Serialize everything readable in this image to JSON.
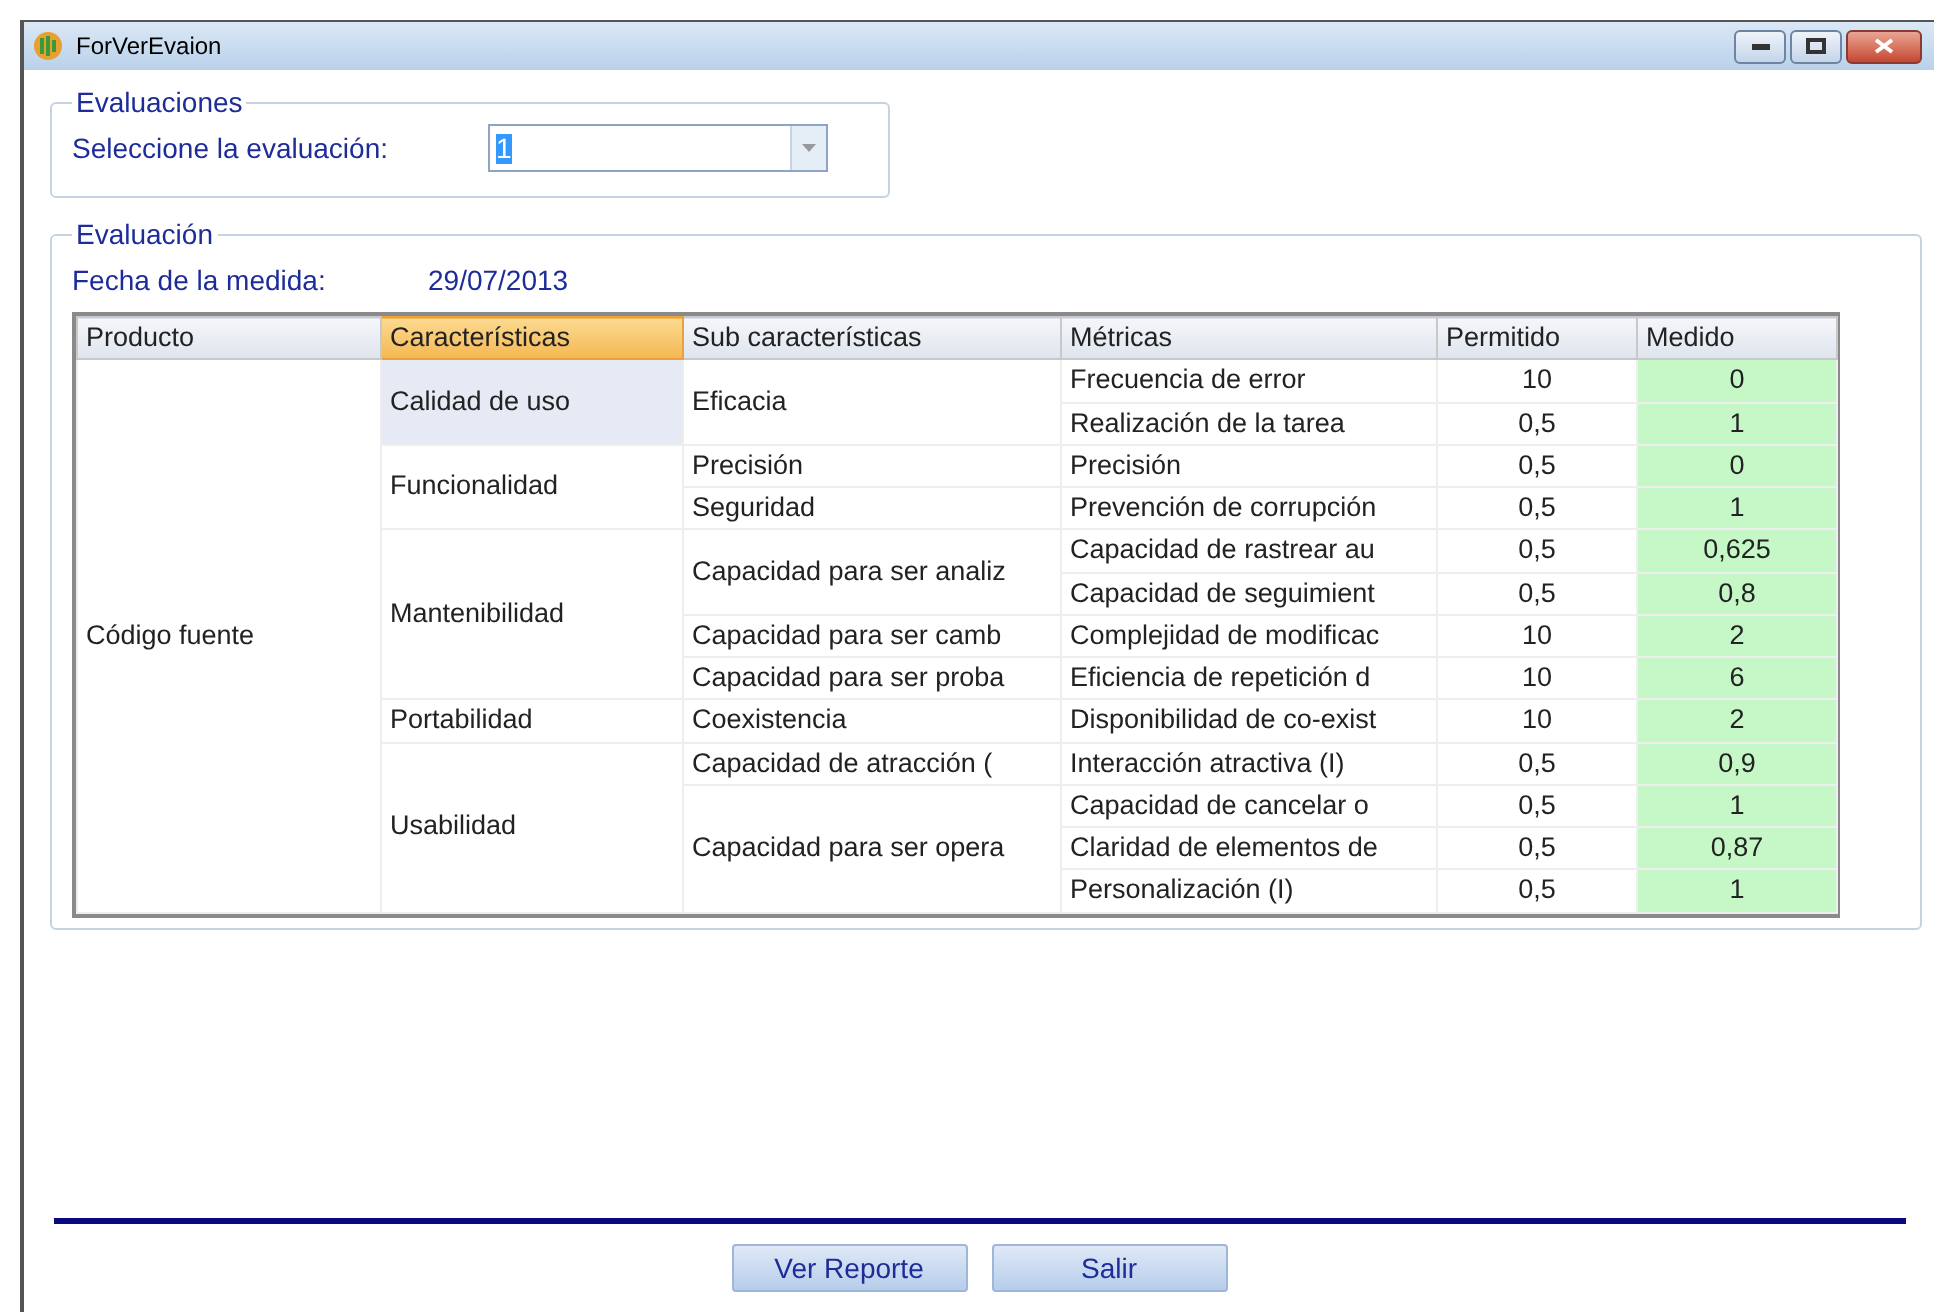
{
  "window": {
    "title": "ForVerEvaion"
  },
  "evaluaciones": {
    "legend": "Evaluaciones",
    "label": "Seleccione la evaluación:",
    "value": "1"
  },
  "evaluacion": {
    "legend": "Evaluación",
    "date_label": "Fecha de la medida:",
    "date": "29/07/2013"
  },
  "table": {
    "columns": [
      {
        "label": "Producto",
        "selected": false
      },
      {
        "label": "Características",
        "selected": true
      },
      {
        "label": "Sub características",
        "selected": false
      },
      {
        "label": "Métricas",
        "selected": false
      },
      {
        "label": "Permitido",
        "selected": false
      },
      {
        "label": "Medido",
        "selected": false
      }
    ],
    "product": "Código fuente",
    "characteristics": [
      {
        "name": "Calidad de uso",
        "selected": true,
        "subs": [
          {
            "name": "Eficacia",
            "metrics": [
              {
                "name": "Frecuencia de error",
                "permitido": "10",
                "medido": "0"
              },
              {
                "name": "Realización de la tarea",
                "permitido": "0,5",
                "medido": "1"
              }
            ]
          }
        ]
      },
      {
        "name": "Funcionalidad",
        "selected": false,
        "subs": [
          {
            "name": "Precisión",
            "metrics": [
              {
                "name": "Precisión",
                "permitido": "0,5",
                "medido": "0"
              }
            ]
          },
          {
            "name": "Seguridad",
            "metrics": [
              {
                "name": "Prevención de corrupción",
                "permitido": "0,5",
                "medido": "1"
              }
            ]
          }
        ]
      },
      {
        "name": "Mantenibilidad",
        "selected": false,
        "subs": [
          {
            "name": "Capacidad para ser analiz",
            "metrics": [
              {
                "name": "Capacidad de rastrear au",
                "permitido": "0,5",
                "medido": "0,625"
              },
              {
                "name": "Capacidad de seguimient",
                "permitido": "0,5",
                "medido": "0,8"
              }
            ]
          },
          {
            "name": "Capacidad para ser camb",
            "metrics": [
              {
                "name": "Complejidad de modificac",
                "permitido": "10",
                "medido": "2"
              }
            ]
          },
          {
            "name": "Capacidad para ser proba",
            "metrics": [
              {
                "name": "Eficiencia de repetición d",
                "permitido": "10",
                "medido": "6"
              }
            ]
          }
        ]
      },
      {
        "name": "Portabilidad",
        "selected": false,
        "subs": [
          {
            "name": "Coexistencia",
            "metrics": [
              {
                "name": "Disponibilidad de co-exist",
                "permitido": "10",
                "medido": "2"
              }
            ]
          }
        ]
      },
      {
        "name": "Usabilidad",
        "selected": false,
        "subs": [
          {
            "name": "Capacidad de atracción  (",
            "metrics": [
              {
                "name": "Interacción atractiva (I)",
                "permitido": "0,5",
                "medido": "0,9"
              }
            ]
          },
          {
            "name": "Capacidad para ser opera",
            "metrics": [
              {
                "name": "Capacidad de cancelar o",
                "permitido": "0,5",
                "medido": "1"
              },
              {
                "name": "Claridad de elementos de",
                "permitido": "0,5",
                "medido": "0,87"
              },
              {
                "name": "Personalización (I)",
                "permitido": "0,5",
                "medido": "1"
              }
            ]
          }
        ]
      }
    ]
  },
  "buttons": [
    "Ver Reporte",
    "Salir"
  ]
}
